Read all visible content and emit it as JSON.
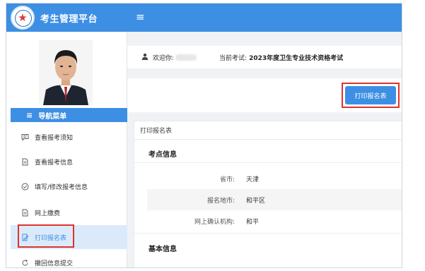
{
  "app": {
    "title": "考生管理平台"
  },
  "sidebar": {
    "nav_header": "导航菜单",
    "items": [
      {
        "label": "查看报考须知",
        "icon": "chat-icon"
      },
      {
        "label": "查看报考信息",
        "icon": "document-icon"
      },
      {
        "label": "填写/修改报考信息",
        "icon": "check-circle-icon"
      },
      {
        "label": "网上缴费",
        "icon": "document-icon"
      },
      {
        "label": "打印报名表",
        "icon": "edit-document-icon",
        "active": true
      },
      {
        "label": "撤回信息提交",
        "icon": "refresh-icon"
      }
    ]
  },
  "header": {
    "welcome_label": "欢迎你:",
    "exam_label": "当前考试:",
    "exam_name": "2023年度卫生专业技术资格考试"
  },
  "toolbar": {
    "print_label": "打印报名表"
  },
  "panel": {
    "title": "打印报名表",
    "section_exam": "考点信息",
    "fields": [
      {
        "label": "省市:",
        "value": "天津"
      },
      {
        "label": "报名地市:",
        "value": "和平区"
      },
      {
        "label": "网上确认机构:",
        "value": "和平"
      }
    ],
    "section_basic": "基本信息"
  },
  "colors": {
    "accent": "#3d8fe4",
    "highlight": "#e0322c",
    "active_bg": "#dbeafa"
  }
}
